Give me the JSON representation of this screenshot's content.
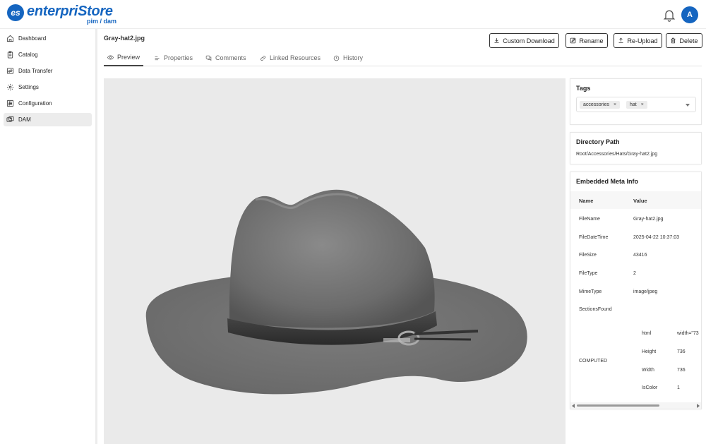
{
  "brand": {
    "mark": "es",
    "name": "enterpriStore",
    "tagline": "pim / dam",
    "color": "#1565c0"
  },
  "header": {
    "notifications_icon": "bell-icon",
    "user_initial": "A"
  },
  "sidebar": {
    "items": [
      {
        "label": "Dashboard",
        "icon": "home-icon"
      },
      {
        "label": "Catalog",
        "icon": "clipboard-icon"
      },
      {
        "label": "Data Transfer",
        "icon": "transfer-icon"
      },
      {
        "label": "Settings",
        "icon": "gear-icon"
      },
      {
        "label": "Configuration",
        "icon": "sliders-icon"
      },
      {
        "label": "DAM",
        "icon": "images-icon",
        "active": true
      }
    ]
  },
  "asset": {
    "file_name": "Gray-hat2.jpg"
  },
  "toolbar": {
    "custom_download": "Custom Download",
    "rename": "Rename",
    "reupload": "Re-Upload",
    "delete": "Delete"
  },
  "tabs": [
    {
      "label": "Preview",
      "icon": "eye-icon",
      "active": true
    },
    {
      "label": "Properties",
      "icon": "list-icon"
    },
    {
      "label": "Comments",
      "icon": "comments-icon"
    },
    {
      "label": "Linked Resources",
      "icon": "link-icon"
    },
    {
      "label": "History",
      "icon": "clock-icon"
    }
  ],
  "tags_panel": {
    "title": "Tags",
    "tags": [
      "accessories",
      "hat"
    ]
  },
  "directory_panel": {
    "title": "Directory Path",
    "path": "Root/Accessories/Hats/Gray-hat2.jpg"
  },
  "meta_panel": {
    "title": "Embedded Meta Info",
    "col_name": "Name",
    "col_value": "Value",
    "rows": [
      {
        "name": "FileName",
        "value": "Gray-hat2.jpg"
      },
      {
        "name": "FileDateTime",
        "value": "2025-04-22 10:37:03"
      },
      {
        "name": "FileSize",
        "value": "43416"
      },
      {
        "name": "FileType",
        "value": "2"
      },
      {
        "name": "MimeType",
        "value": "image/jpeg"
      },
      {
        "name": "SectionsFound",
        "value": ""
      }
    ],
    "computed_label": "COMPUTED",
    "computed": [
      {
        "key": "html",
        "value": "width=\"73"
      },
      {
        "key": "Height",
        "value": "736"
      },
      {
        "key": "Width",
        "value": "736"
      },
      {
        "key": "IsColor",
        "value": "1"
      }
    ]
  }
}
